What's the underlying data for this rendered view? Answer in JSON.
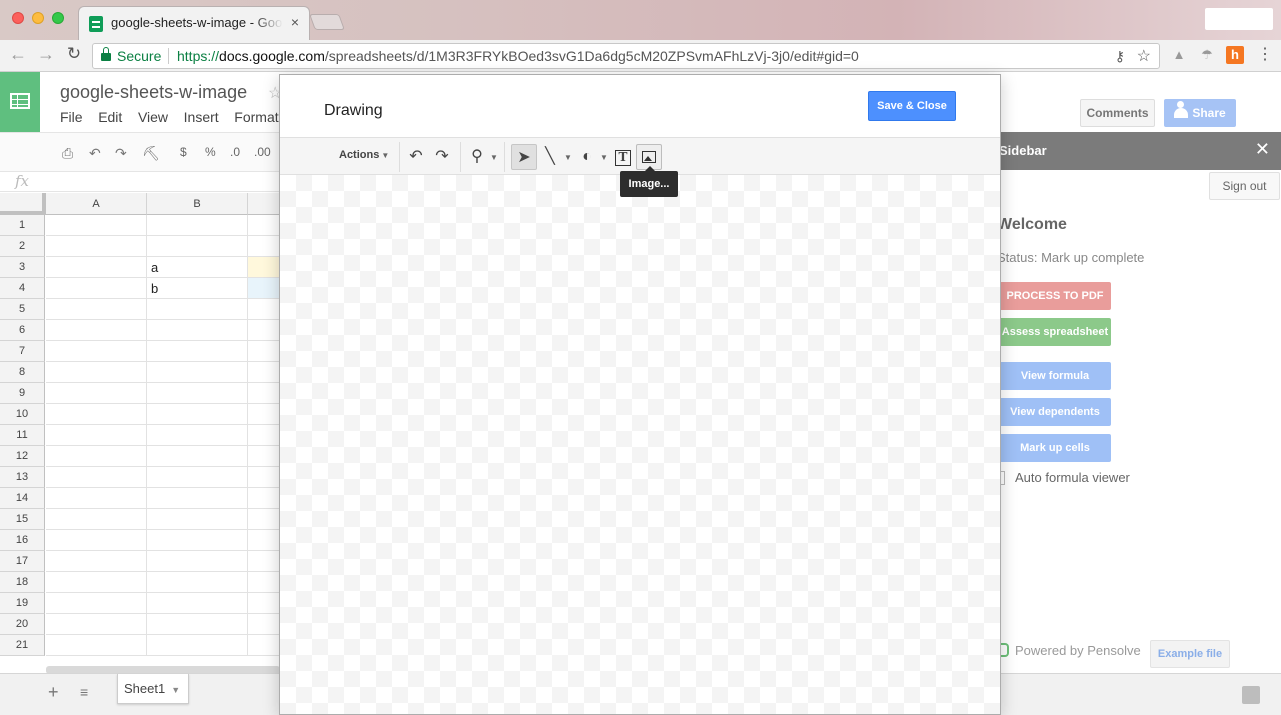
{
  "browser": {
    "tab_title": "google-sheets-w-image - Google Sheets",
    "tab_close": "×",
    "secure_label": "Secure",
    "url_scheme": "https://",
    "url_host": "docs.google.com",
    "url_path": "/spreadsheets/d/1M3R3FRYkBOed3svG1Da6dg5cM20ZPSvmAFhLzVj-3j0/edit#gid=0"
  },
  "sheets": {
    "doc_title": "google-sheets-w-image",
    "menu": [
      "File",
      "Edit",
      "View",
      "Insert",
      "Format"
    ],
    "comments_label": "Comments",
    "share_label": "Share",
    "formula_icon": "fx",
    "toolbar": {
      "currency": "$",
      "percent": "%",
      "dec_decrease": ".0",
      "dec_increase": ".00"
    },
    "columns": [
      "A",
      "B"
    ],
    "rows": [
      "1",
      "2",
      "3",
      "4",
      "5",
      "6",
      "7",
      "8",
      "9",
      "10",
      "11",
      "12",
      "13",
      "14",
      "15",
      "16",
      "17",
      "18",
      "19",
      "20",
      "21"
    ],
    "cells": {
      "B3": "a",
      "B4": "b"
    },
    "sheet_tab": "Sheet1"
  },
  "drawing_dialog": {
    "title": "Drawing",
    "save_close_label": "Save & Close",
    "actions_label": "Actions",
    "tooltip": "Image..."
  },
  "sidebar": {
    "title": "Sidebar",
    "close": "✕",
    "signout_label": "Sign out",
    "welcome": "Welcome",
    "status": "Status: Mark up complete",
    "buttons": {
      "process_pdf": "PROCESS TO PDF",
      "assess": "Assess spreadsheet",
      "view_formula": "View formula",
      "view_dependents": "View dependents",
      "mark_up": "Mark up cells"
    },
    "auto_formula_label": "Auto formula viewer",
    "powered_by": "Powered by Pensolve",
    "example_file_label": "Example file"
  },
  "colors": {
    "sheets_green": "#0f9d58",
    "save_blue": "#4d90fe",
    "pdf_red": "#e99d9b",
    "assess_green": "#8cc98a",
    "action_blue": "#9fc0f6"
  }
}
